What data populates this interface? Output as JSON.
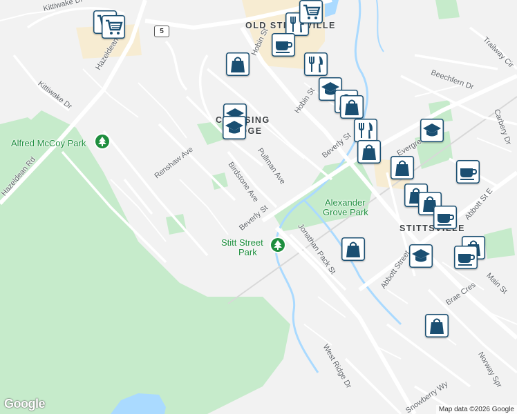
{
  "map": {
    "roads": {
      "hazeldean_rd_north": "Hazeldean Rd",
      "hazeldean_rd_west": "Hazeldean Rd",
      "kittiwake_dr_north": "Kittiwake Dr",
      "kittiwake_dr": "Kittiwake Dr",
      "hobin_st_north": "Hobin St",
      "hobin_st": "Hobin St",
      "renshaw_ave": "Renshaw Ave",
      "pullman_ave": "Pullman Ave",
      "birdstone_ave": "Birdstone Ave",
      "beverly_st": "Beverly St",
      "beverly_st_north": "Beverly St",
      "jonathan_pack_st": "Jonathan Pack St",
      "abbott_st": "Abbott Street",
      "abbott_st_e": "Abbott St E",
      "main_st": "Main St",
      "brae_cres": "Brae Cres",
      "west_ridge_dr": "West Ridge Dr",
      "snowberry_wy": "Snowberry Wy",
      "norway_spruce": "Norway Spr",
      "trailway_cir": "Trailway Cir",
      "beechfern_dr": "Beechfern Dr",
      "carbery_dr": "Carbery Dr",
      "evergreen": "Evergreen"
    },
    "areas": {
      "old_stittsville": "OLD STITTSVILLE",
      "crossing_bridge_a": "CROSSING",
      "crossing_bridge_b": "BRIDGE",
      "stittsville": "STITTSVILLE"
    },
    "parks": {
      "alfred_mccoy": "Alfred McCoy Park",
      "alexander_grove_a": "Alexander",
      "alexander_grove_b": "Grove Park",
      "stitt_street_a": "Stitt Street",
      "stitt_street_b": "Park"
    },
    "highway_shield": "5",
    "pois": [
      {
        "icon": "shopping-cart-icon"
      },
      {
        "icon": "shopping-cart-icon"
      },
      {
        "icon": "restaurant-icon"
      },
      {
        "icon": "shopping-cart-icon"
      },
      {
        "icon": "cafe-icon"
      },
      {
        "icon": "shopping-bag-icon"
      },
      {
        "icon": "restaurant-icon"
      },
      {
        "icon": "school-icon"
      },
      {
        "icon": "shopping-bag-icon"
      },
      {
        "icon": "school-icon"
      },
      {
        "icon": "school-icon"
      },
      {
        "icon": "shopping-bag-icon"
      },
      {
        "icon": "restaurant-icon"
      },
      {
        "icon": "shopping-bag-icon"
      },
      {
        "icon": "school-icon"
      },
      {
        "icon": "shopping-bag-icon"
      },
      {
        "icon": "cafe-icon"
      },
      {
        "icon": "shopping-bag-icon"
      },
      {
        "icon": "shopping-bag-icon"
      },
      {
        "icon": "cafe-icon"
      },
      {
        "icon": "shopping-bag-icon"
      },
      {
        "icon": "school-icon"
      },
      {
        "icon": "shopping-bag-icon"
      },
      {
        "icon": "cafe-icon"
      },
      {
        "icon": "shopping-bag-icon"
      }
    ],
    "colors": {
      "background": "#f2f2f2",
      "green_space": "#c6ebcb",
      "water": "#aadaff",
      "commercial": "#f7ecd2",
      "road": "#ffffff",
      "poi_icon": "#1a4f72"
    },
    "branding": "Google",
    "attribution": "Map data ©2026 Google"
  }
}
